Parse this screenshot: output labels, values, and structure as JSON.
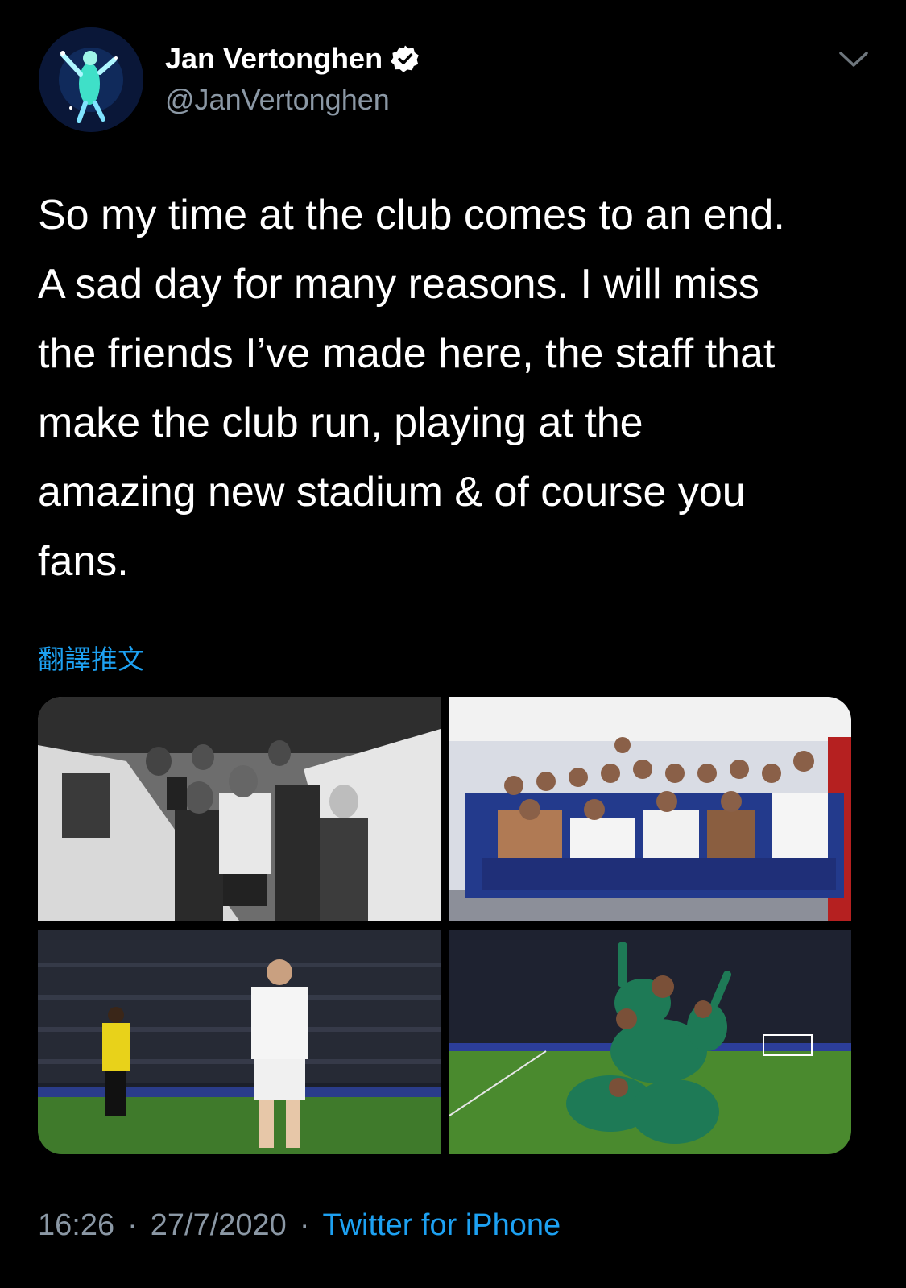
{
  "author": {
    "name": "Jan Vertonghen",
    "handle": "@JanVertonghen",
    "verified": true,
    "avatar_icon": "avatar-player-icon"
  },
  "tweet": {
    "text": "So my time at the club comes to an end.\nA sad day for many reasons. I will miss\nthe friends I’ve made here, the staff that\nmake the club run, playing at the\namazing new stadium & of course you\nfans.",
    "translate_label": "翻譯推文"
  },
  "media": [
    {
      "icon": "tunnel-photo"
    },
    {
      "icon": "dressing-room-team-photo"
    },
    {
      "icon": "stadium-match-photo"
    },
    {
      "icon": "celebration-photo"
    }
  ],
  "meta": {
    "time": "16:26",
    "date": "27/7/2020",
    "separator": "·",
    "source": "Twitter for iPhone"
  },
  "colors": {
    "background": "#000000",
    "text": "#ffffff",
    "secondary": "#8b98a5",
    "link": "#1da1f2"
  }
}
